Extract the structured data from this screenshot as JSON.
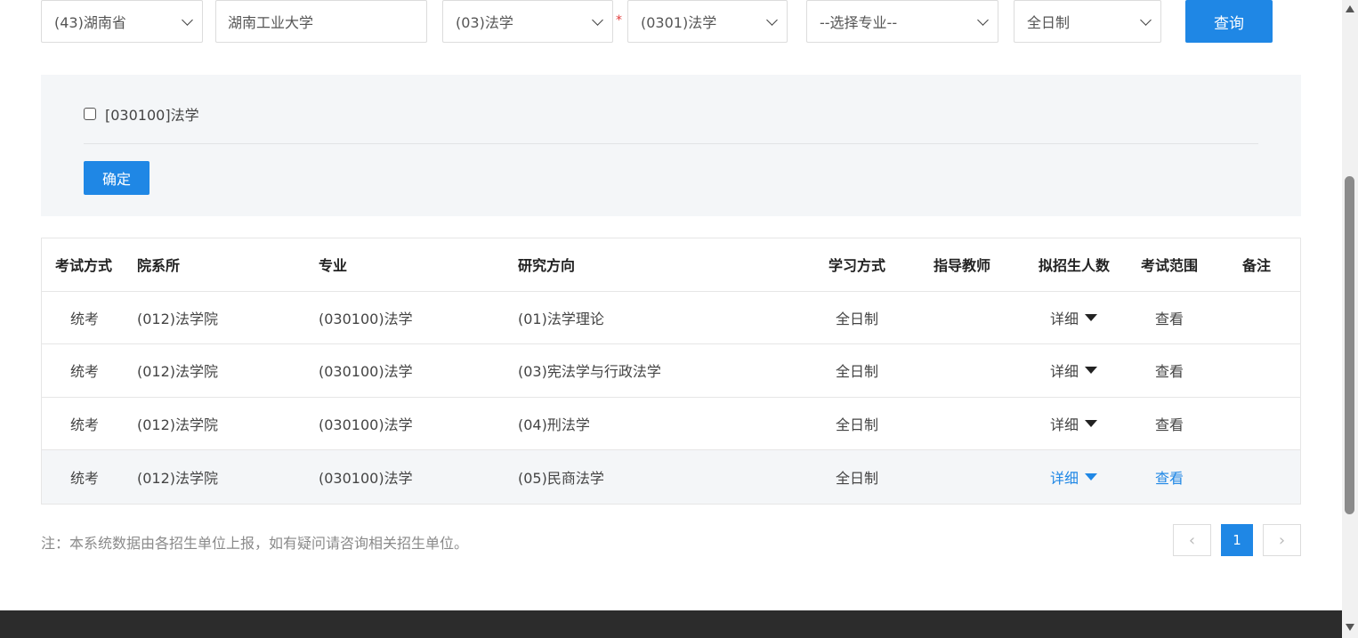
{
  "filters": {
    "province": "(43)湖南省",
    "school": "湖南工业大学",
    "discipline_category": "(03)法学",
    "required_mark": "*",
    "discipline": "(0301)法学",
    "major": "--选择专业--",
    "study_mode": "全日制",
    "query_label": "查询"
  },
  "major_panel": {
    "checkbox_label": "[030100]法学",
    "confirm_label": "确定"
  },
  "table": {
    "headers": [
      "考试方式",
      "院系所",
      "专业",
      "研究方向",
      "学习方式",
      "指导教师",
      "拟招生人数",
      "考试范围",
      "备注"
    ],
    "rows": [
      {
        "exam": "统考",
        "dept": "(012)法学院",
        "major": "(030100)法学",
        "direction": "(01)法学理论",
        "mode": "全日制",
        "advisor": "",
        "quota": "详细",
        "scope": "查看",
        "remark": ""
      },
      {
        "exam": "统考",
        "dept": "(012)法学院",
        "major": "(030100)法学",
        "direction": "(03)宪法学与行政法学",
        "mode": "全日制",
        "advisor": "",
        "quota": "详细",
        "scope": "查看",
        "remark": ""
      },
      {
        "exam": "统考",
        "dept": "(012)法学院",
        "major": "(030100)法学",
        "direction": "(04)刑法学",
        "mode": "全日制",
        "advisor": "",
        "quota": "详细",
        "scope": "查看",
        "remark": ""
      },
      {
        "exam": "统考",
        "dept": "(012)法学院",
        "major": "(030100)法学",
        "direction": "(05)民商法学",
        "mode": "全日制",
        "advisor": "",
        "quota": "详细",
        "scope": "查看",
        "remark": ""
      }
    ]
  },
  "note": "注：本系统数据由各招生单位上报，如有疑问请咨询相关招生单位。",
  "pagination": {
    "prev": "‹",
    "current": "1",
    "next": "›"
  },
  "colors": {
    "accent": "#1f87e5",
    "footer": "#2c2c2c",
    "panel_bg": "#f4f6f8"
  }
}
